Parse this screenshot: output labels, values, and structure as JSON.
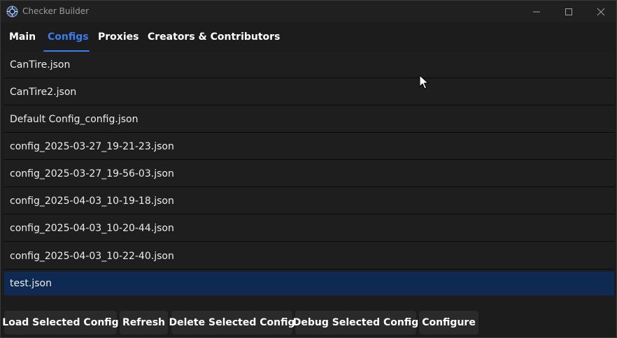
{
  "window": {
    "title": "Checker Builder"
  },
  "tabs": [
    {
      "label": "Main"
    },
    {
      "label": "Configs"
    },
    {
      "label": "Proxies"
    },
    {
      "label": "Creators & Contributors"
    }
  ],
  "active_tab": "Configs",
  "configs": [
    {
      "name": "CanTire.json"
    },
    {
      "name": "CanTire2.json"
    },
    {
      "name": "Default Config_config.json"
    },
    {
      "name": "config_2025-03-27_19-21-23.json"
    },
    {
      "name": "config_2025-03-27_19-56-03.json"
    },
    {
      "name": "config_2025-04-03_10-19-18.json"
    },
    {
      "name": "config_2025-04-03_10-20-44.json"
    },
    {
      "name": "config_2025-04-03_10-22-40.json"
    },
    {
      "name": "test.json"
    }
  ],
  "selected_config": "test.json",
  "buttons": {
    "load": "Load Selected Config",
    "refresh": "Refresh",
    "delete": "Delete Selected Config",
    "debug": "Debug Selected Config",
    "configure": "Configure"
  },
  "colors": {
    "accent": "#3a7df0",
    "selected_row": "#0f2a52",
    "background": "#1c1c1c",
    "button": "#2a2a2a"
  },
  "icons": {
    "app": "app-logo-icon",
    "minimize": "minimize-icon",
    "maximize": "maximize-icon",
    "close": "close-icon"
  }
}
